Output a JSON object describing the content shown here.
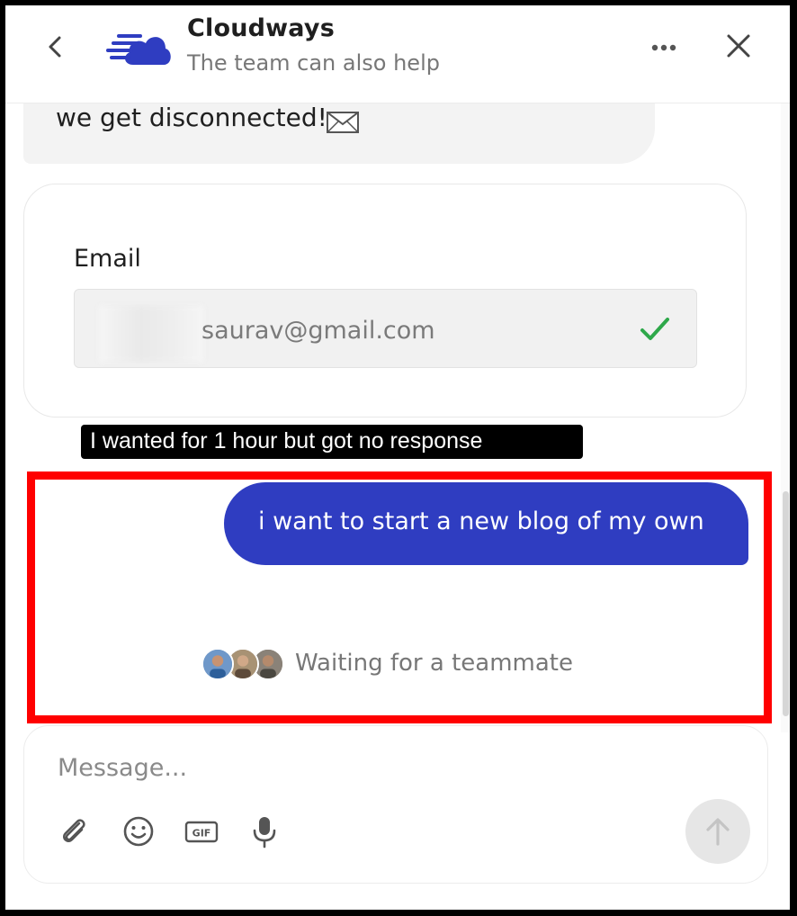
{
  "header": {
    "title": "Cloudways",
    "subtitle": "The team can also help"
  },
  "conversation": {
    "previous_message": "we get disconnected!",
    "email_card": {
      "label": "Email",
      "value": "saurav@gmail.com",
      "status": "verified"
    },
    "annotation_caption": "I wanted for 1 hour but got no response",
    "user_message": "i want to start a new blog of my own",
    "waiting_status": "Waiting for a teammate"
  },
  "composer": {
    "placeholder": "Message...",
    "tools": [
      "paperclip-icon",
      "emoji-icon",
      "gif-icon",
      "microphone-icon"
    ],
    "send_icon": "arrow-up-icon"
  },
  "colors": {
    "brand_blue": "#2f3dc1",
    "highlight_red": "#ff0000",
    "check_green": "#2ea84a"
  }
}
